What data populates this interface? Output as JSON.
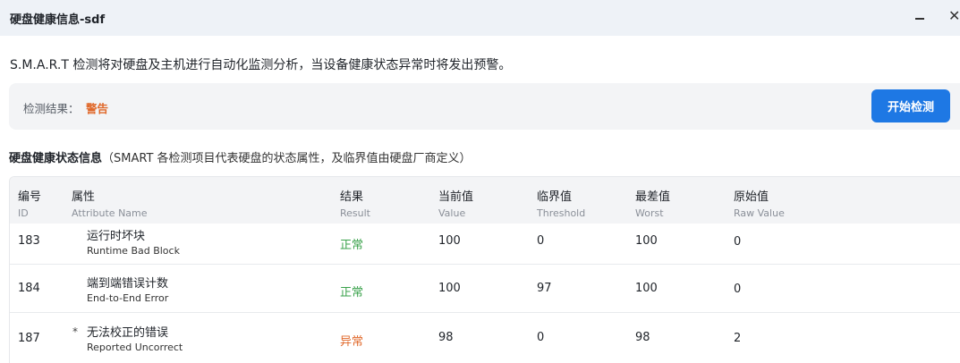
{
  "window": {
    "title": "硬盘健康信息-sdf",
    "minimize_icon": "minimize-icon",
    "close_glyph": "✕",
    "close_icon": "close-icon"
  },
  "intro_text": "S.M.A.R.T 检测将对硬盘及主机进行自动化监测分析，当设备健康状态异常时将发出预警。",
  "result": {
    "label": "检测结果：",
    "value": "警告",
    "start_button": "开始检测"
  },
  "section": {
    "title": "硬盘健康状态信息",
    "description": "（SMART 各检测项目代表硬盘的状态属性，及临界值由硬盘厂商定义）"
  },
  "table": {
    "headers": [
      {
        "zh": "编号",
        "en": "ID"
      },
      {
        "zh": "属性",
        "en": "Attribute Name"
      },
      {
        "zh": "结果",
        "en": "Result"
      },
      {
        "zh": "当前值",
        "en": "Value"
      },
      {
        "zh": "临界值",
        "en": "Threshold"
      },
      {
        "zh": "最差值",
        "en": "Worst"
      },
      {
        "zh": "原始值",
        "en": "Raw Value"
      }
    ],
    "rows": [
      {
        "id": "183",
        "flag": "",
        "attr_zh": "运行时坏块",
        "attr_en": "Runtime Bad Block",
        "result": "正常",
        "value": "100",
        "threshold": "0",
        "worst": "100",
        "raw": "0"
      },
      {
        "id": "184",
        "flag": "",
        "attr_zh": "端到端错误计数",
        "attr_en": "End-to-End Error",
        "result": "正常",
        "value": "100",
        "threshold": "97",
        "worst": "100",
        "raw": "0"
      },
      {
        "id": "187",
        "flag": "*",
        "attr_zh": "无法校正的错误",
        "attr_en": "Reported Uncorrect",
        "result": "异常",
        "value": "98",
        "threshold": "0",
        "worst": "98",
        "raw": "2"
      }
    ]
  },
  "colors": {
    "accent": "#1e78e4",
    "warning": "#e0682a",
    "ok": "#3aa24b"
  }
}
